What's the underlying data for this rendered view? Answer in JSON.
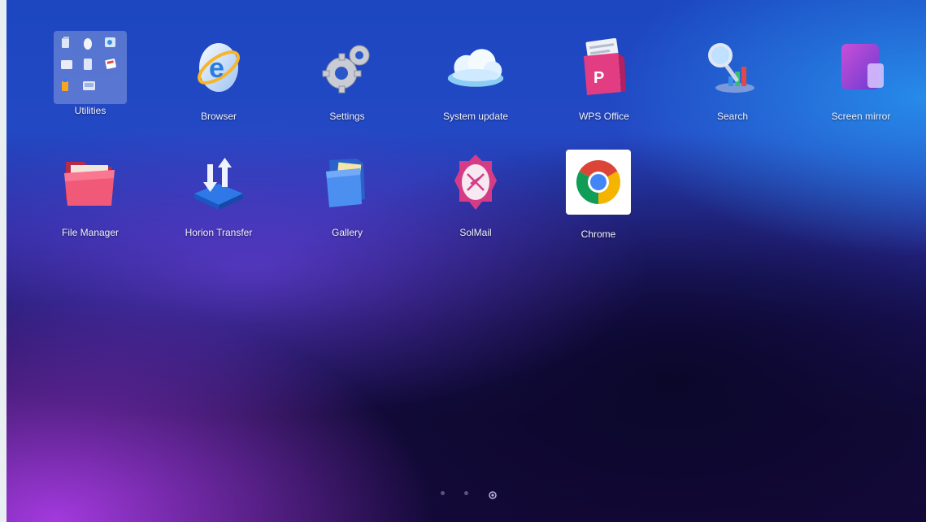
{
  "launcher": {
    "apps": [
      {
        "label": "Utilities",
        "icon": "utilities-folder-icon"
      },
      {
        "label": "Browser",
        "icon": "browser-e-icon"
      },
      {
        "label": "Settings",
        "icon": "settings-gears-icon"
      },
      {
        "label": "System update",
        "icon": "cloud-update-icon"
      },
      {
        "label": "WPS Office",
        "icon": "wps-office-icon"
      },
      {
        "label": "Search",
        "icon": "search-magnifier-icon"
      },
      {
        "label": "Screen mirror",
        "icon": "screen-mirror-icon"
      },
      {
        "label": "File Manager",
        "icon": "folder-icon"
      },
      {
        "label": "Horion Transfer",
        "icon": "transfer-arrows-icon"
      },
      {
        "label": "Gallery",
        "icon": "gallery-folder-icon"
      },
      {
        "label": "SolMail",
        "icon": "mail-icon"
      },
      {
        "label": "Chrome",
        "icon": "chrome-icon"
      }
    ],
    "pages": {
      "count": 3,
      "current": 3
    }
  },
  "colors": {
    "wallpaper_top": "#1c47c0",
    "wallpaper_purple": "#aa3ce6",
    "wallpaper_dark": "#160a3d",
    "label_text": "#f1f3ff"
  }
}
